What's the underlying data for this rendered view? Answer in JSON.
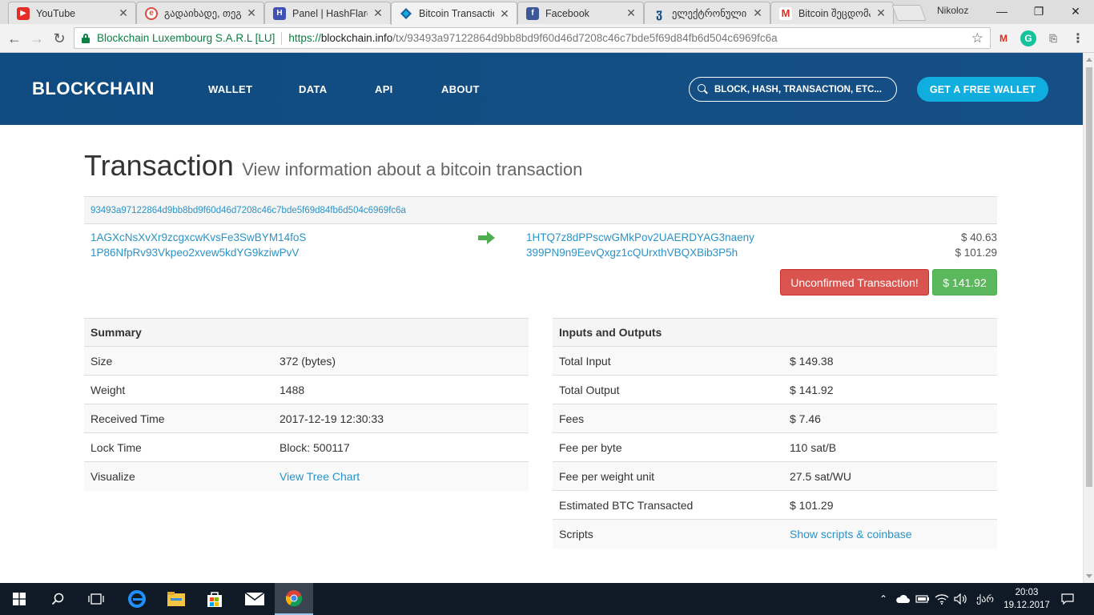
{
  "browser": {
    "tabs": [
      {
        "label": "YouTube",
        "icon": "youtube-icon",
        "color": "#e52d27"
      },
      {
        "label": "გადაიხადე, თეგ",
        "icon": "search-engine-icon",
        "color": "#d94b3f"
      },
      {
        "label": "Panel | HashFlare (",
        "icon": "hashflare-icon",
        "color": "#3f51b5"
      },
      {
        "label": "Bitcoin Transactio",
        "icon": "blockchain-icon",
        "color": "#1b5fa6",
        "active": true
      },
      {
        "label": "Facebook",
        "icon": "facebook-icon",
        "color": "#3b5998"
      },
      {
        "label": "ელექტრონული",
        "icon": "gov-icon",
        "color": "#1b4f84"
      },
      {
        "label": "Bitcoin შეცდომა",
        "icon": "gmail-icon",
        "color": "#d93025"
      }
    ],
    "profile_name": "Nikoloz",
    "secure_org": "Blockchain Luxembourg S.A.R.L [LU]",
    "url_scheme": "https://",
    "url_host": "blockchain.info",
    "url_path": "/tx/93493a97122864d9bb8bd9f60d46d7208c46c7bde5f69d84fb6d504c6969fc6a"
  },
  "site": {
    "logo": "BLOCKCHAIN",
    "nav": [
      "WALLET",
      "DATA",
      "API",
      "ABOUT"
    ],
    "search_placeholder": "BLOCK, HASH, TRANSACTION, ETC...",
    "cta": "GET A FREE WALLET"
  },
  "page": {
    "title": "Transaction",
    "subtitle": "View information about a bitcoin transaction",
    "tx_hash": "93493a97122864d9bb8bd9f60d46d7208c46c7bde5f69d84fb6d504c6969fc6a",
    "inputs": [
      "1AGXcNsXvXr9zcgxcwKvsFe3SwBYM14foS",
      "1P86NfpRv93Vkpeo2xvew5kdYG9kziwPvV"
    ],
    "outputs": [
      {
        "address": "1HTQ7z8dPPscwGMkPov2UAERDYAG3naeny",
        "amount": "$ 40.63"
      },
      {
        "address": "399PN9n9EevQxgz1cQUrxthVBQXBib3P5h",
        "amount": "$ 101.29"
      }
    ],
    "status_label": "Unconfirmed Transaction!",
    "total_label": "$ 141.92"
  },
  "summary": {
    "heading": "Summary",
    "rows": [
      {
        "k": "Size",
        "v": "372 (bytes)"
      },
      {
        "k": "Weight",
        "v": "1488"
      },
      {
        "k": "Received Time",
        "v": "2017-12-19 12:30:33"
      },
      {
        "k": "Lock Time",
        "v": "Block: 500117"
      },
      {
        "k": "Visualize",
        "v": "View Tree Chart",
        "link": true
      }
    ]
  },
  "io_table": {
    "heading": "Inputs and Outputs",
    "rows": [
      {
        "k": "Total Input",
        "v": "$ 149.38"
      },
      {
        "k": "Total Output",
        "v": "$ 141.92"
      },
      {
        "k": "Fees",
        "v": "$ 7.46"
      },
      {
        "k": "Fee per byte",
        "v": "110 sat/B"
      },
      {
        "k": "Fee per weight unit",
        "v": "27.5 sat/WU"
      },
      {
        "k": "Estimated BTC Transacted",
        "v": "$ 101.29"
      },
      {
        "k": "Scripts",
        "v": "Show scripts & coinbase",
        "link": true
      }
    ]
  },
  "taskbar": {
    "language": "ქარ",
    "time": "20:03",
    "date": "19.12.2017"
  },
  "colors": {
    "header_blue": "#154f86",
    "cta_blue": "#10addf",
    "link_blue": "#2a93c8",
    "danger_red": "#d9534f",
    "success_green": "#5cb85c"
  }
}
